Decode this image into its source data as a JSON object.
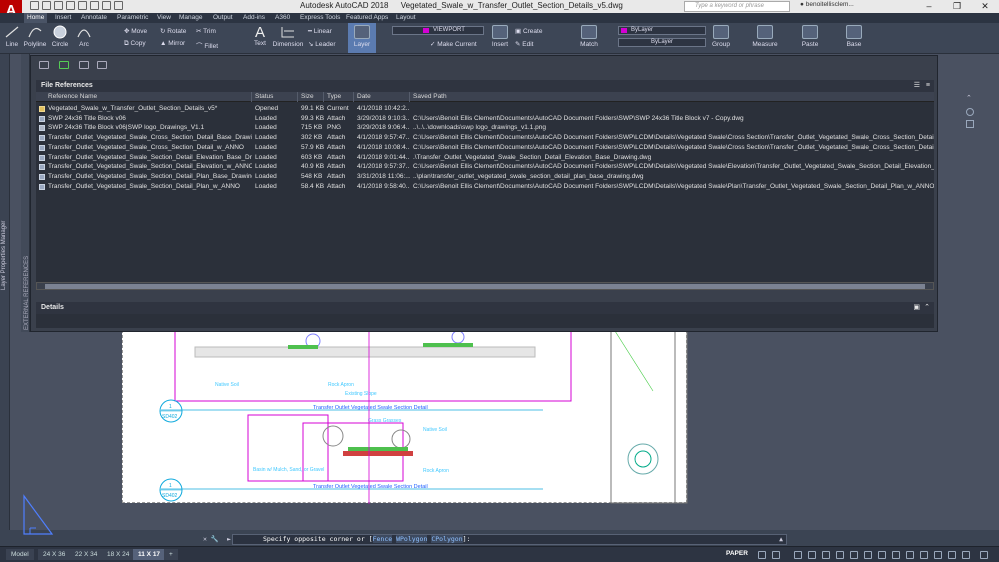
{
  "app": {
    "logo_letter": "A",
    "title_app": "Autodesk AutoCAD 2018",
    "title_file": "Vegetated_Swale_w_Transfer_Outlet_Section_Details_v5.dwg",
    "search_placeholder": "Type a keyword or phrase",
    "user": "benoitellisclem..."
  },
  "ribbon_tabs": [
    "Home",
    "Insert",
    "Annotate",
    "Parametric",
    "View",
    "Manage",
    "Output",
    "Add-ins",
    "A360",
    "Express Tools",
    "Featured Apps",
    "Layout"
  ],
  "ribbon": {
    "draw": [
      "Line",
      "Polyline",
      "Circle",
      "Arc"
    ],
    "modify": [
      "Move",
      "Rotate",
      "Trim",
      "Copy",
      "Mirror",
      "Fillet"
    ],
    "text": "Text",
    "dimension": "Dimension",
    "linear": "Linear",
    "leader": "Leader",
    "layer": "Layer",
    "viewport_layer": "VIEWPORT",
    "make_current": "Make Current",
    "insert": "Insert",
    "create": "Create",
    "edit": "Edit",
    "match": "Match",
    "bylayer": "ByLayer",
    "bylayer2": "ByLayer",
    "group": "Group",
    "measure": "Measure",
    "paste": "Paste",
    "base": "Base"
  },
  "palette": {
    "strip_label": "Layer Properties Manager",
    "side_label": "EXTERNAL REFERENCES",
    "file_references": "File References",
    "details": "Details",
    "columns": [
      "Reference Name",
      "Status",
      "Size",
      "Type",
      "Date",
      "Saved Path"
    ],
    "rows": [
      {
        "name": "Vegetated_Swale_w_Transfer_Outlet_Section_Details_v5*",
        "status": "Opened",
        "size": "99.1 KB",
        "type": "Current",
        "date": "4/1/2018 10:42:2...",
        "path": ""
      },
      {
        "name": "SWP 24x36 Title Block v06",
        "status": "Loaded",
        "size": "99.3 KB",
        "type": "Attach",
        "date": "3/29/2018 9:10:3...",
        "path": "C:\\Users\\Benoit Ellis Clement\\Documents\\AutoCAD Document Folders\\SWP\\SWP 24x36 Title Block v7 - Copy.dwg"
      },
      {
        "name": "SWP 24x36 Title Block v06|SWP logo_Drawings_V1.1",
        "status": "Loaded",
        "size": "715 KB",
        "type": "PNG",
        "date": "3/29/2018 9:06:4...",
        "path": "..\\..\\..\\downloads\\swp logo_drawings_v1.1.png"
      },
      {
        "name": "Transfer_Outlet_Vegetated_Swale_Cross_Section_Detail_Base_Drawing",
        "status": "Loaded",
        "size": "302 KB",
        "type": "Attach",
        "date": "4/1/2018 9:57:47...",
        "path": "C:\\Users\\Benoit Ellis Clement\\Documents\\AutoCAD Document Folders\\SWP\\LCDM\\Details\\Vegetated Swale\\Cross Section\\Transfer_Outlet_Vegetated_Swale_Cross_Section_Detail_Base_Drawing"
      },
      {
        "name": "Transfer_Outlet_Vegetated_Swale_Cross_Section_Detail_w_ANNO",
        "status": "Loaded",
        "size": "57.9 KB",
        "type": "Attach",
        "date": "4/1/2018 10:08:4...",
        "path": "C:\\Users\\Benoit Ellis Clement\\Documents\\AutoCAD Document Folders\\SWP\\LCDM\\Details\\Vegetated Swale\\Cross Section\\Transfer_Outlet_Vegetated_Swale_Cross_Section_Detail_w_ANNO.dw"
      },
      {
        "name": "Transfer_Outlet_Vegetated_Swale_Section_Detail_Elevation_Base_Drawing",
        "status": "Loaded",
        "size": "603 KB",
        "type": "Attach",
        "date": "4/1/2018 9:01:44...",
        "path": ".\\Transfer_Outlet_Vegetated_Swale_Section_Detail_Elevation_Base_Drawing.dwg"
      },
      {
        "name": "Transfer_Outlet_Vegetated_Swale_Section_Detail_Elevation_w_ANNO",
        "status": "Loaded",
        "size": "40.9 KB",
        "type": "Attach",
        "date": "4/1/2018 9:57:37...",
        "path": "C:\\Users\\Benoit Ellis Clement\\Documents\\AutoCAD Document Folders\\SWP\\LCDM\\Details\\Vegetated Swale\\Elevation\\Transfer_Outlet_Vegetated_Swale_Section_Detail_Elevation_w_ANNO.dw"
      },
      {
        "name": "Transfer_Outlet_Vegetated_Swale_Section_Detail_Plan_Base_Drawing",
        "status": "Loaded",
        "size": "548 KB",
        "type": "Attach",
        "date": "3/31/2018 11:06:...",
        "path": "..\\plan\\transfer_outlet_vegetated_swale_section_detail_plan_base_drawing.dwg"
      },
      {
        "name": "Transfer_Outlet_Vegetated_Swale_Section_Detail_Plan_w_ANNO",
        "status": "Loaded",
        "size": "58.4 KB",
        "type": "Attach",
        "date": "4/1/2018 9:58:40...",
        "path": "C:\\Users\\Benoit Ellis Clement\\Documents\\AutoCAD Document Folders\\SWP\\LCDM\\Details\\Vegetated Swale\\Plan\\Transfer_Outlet_Vegetated_Swale_Section_Detail_Plan_w_ANNO.dwg"
      }
    ]
  },
  "drawing": {
    "label_1": "Native Soil",
    "label_2": "Rock Apron",
    "label_3": "Existing Slope",
    "title_1": "Transfer Outlet Vegetated Swale Section Detail",
    "bubble_1_num": "1",
    "bubble_1_ref": "SD402",
    "label_4": "Native Soil",
    "label_5": "Basin w/ Mulch, Sand, or Gravel",
    "label_6": "Rock Apron",
    "label_7": "Grass Grasses",
    "title_2": "Transfer Outlet Vegetated Swale Section Detail",
    "bubble_2_num": "1",
    "bubble_2_ref": "SD402"
  },
  "command_line": {
    "prefix": "Specify opposite corner or [",
    "fence": "Fence",
    "wpolygon": "WPolygon",
    "cpolygon": "CPolygon",
    "suffix": "]:"
  },
  "layout_tabs": [
    "Model",
    "24 X 36",
    "22 X 34",
    "18 X 24",
    "11 X 17"
  ],
  "status": {
    "paper": "PAPER"
  }
}
